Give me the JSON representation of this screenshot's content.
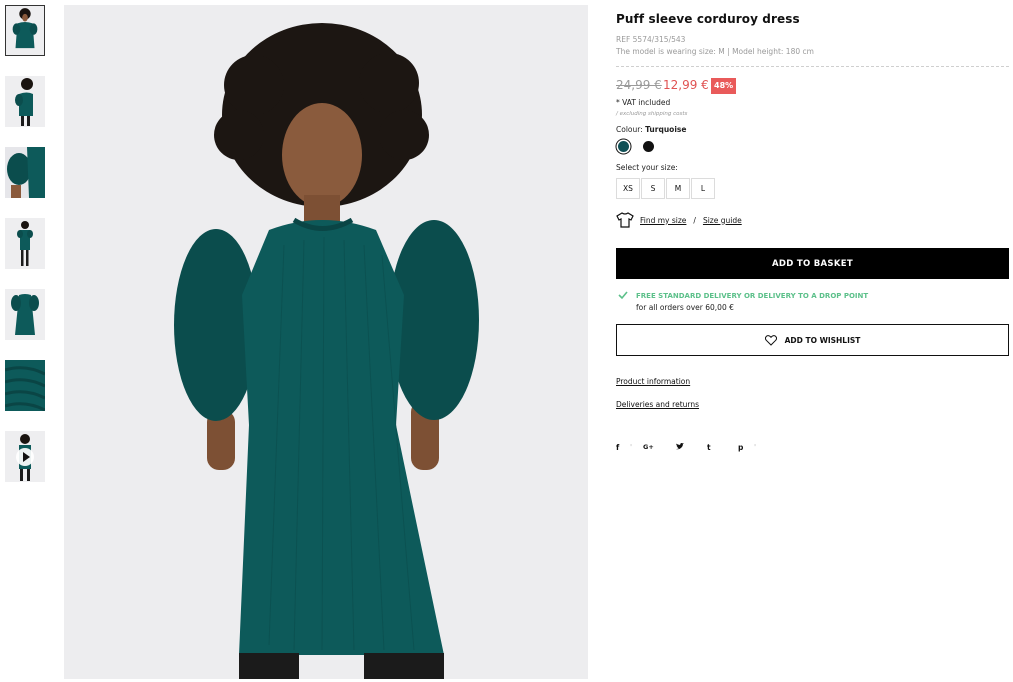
{
  "gallery": {
    "thumbnails": [
      "full-front",
      "side",
      "sleeve-detail",
      "full-body",
      "flat-lay",
      "fabric-detail",
      "video"
    ],
    "active_index": 0
  },
  "product": {
    "title": "Puff sleeve corduroy dress",
    "ref": "REF 5574/315/543",
    "model_info": "The model is wearing size: M | Model height: 180 cm",
    "old_price": "24,99 €",
    "new_price": "12,99 €",
    "discount": "48%",
    "vat": "* VAT included",
    "excluding": "/ excluding shipping costs",
    "colour_label": "Colour:",
    "colour_value": "Turquoise",
    "colours": [
      "#0f4f55",
      "#111111"
    ],
    "size_label": "Select your size:",
    "sizes": [
      "XS",
      "S",
      "M",
      "L"
    ],
    "find_my_size": "Find my size",
    "separator": "/",
    "size_guide": "Size guide"
  },
  "actions": {
    "add_to_basket": "ADD TO BASKET",
    "add_to_wishlist": "ADD TO WISHLIST"
  },
  "delivery": {
    "headline": "FREE STANDARD DELIVERY OR DELIVERY TO A DROP POINT",
    "subline": "for all orders over 60,00 €"
  },
  "links": {
    "product_information": "Product information",
    "deliveries_returns": "Deliveries and returns"
  },
  "social": [
    "f",
    "G+",
    "t-bird",
    "t",
    "p"
  ],
  "colors": {
    "accent_red": "#e05252",
    "delivery_green": "#5cc08a",
    "dress": "#0d5a5a"
  }
}
